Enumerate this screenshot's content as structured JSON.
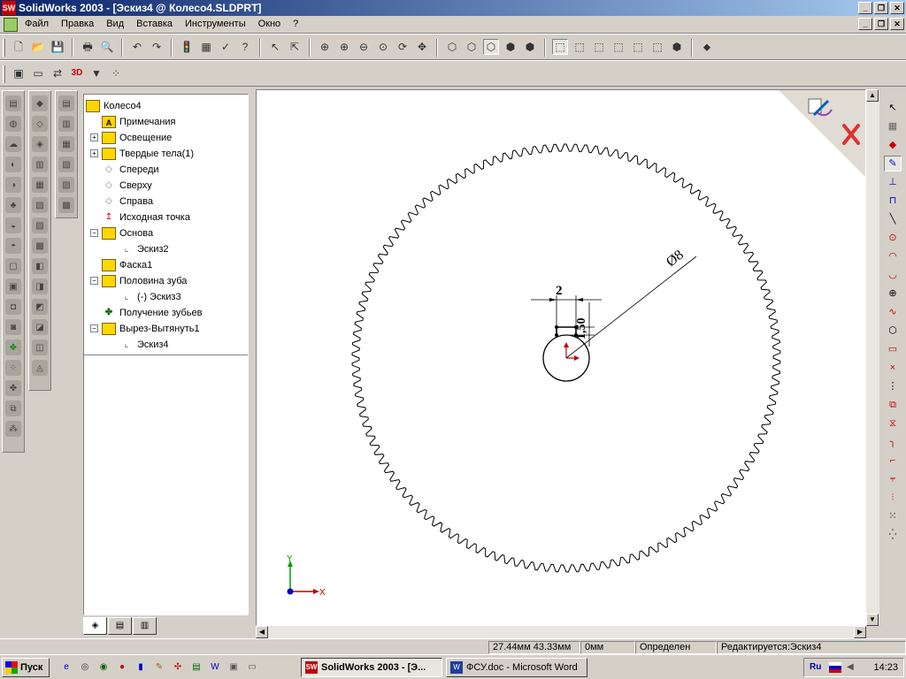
{
  "window": {
    "title": "SolidWorks 2003 - [Эскиз4 @ Колесо4.SLDPRT]",
    "app_icon_text": "SW"
  },
  "menu": {
    "items": [
      "Файл",
      "Правка",
      "Вид",
      "Вставка",
      "Инструменты",
      "Окно",
      "?"
    ]
  },
  "feature_tree": {
    "items": [
      {
        "label": "Колесо4",
        "icon": "part-icon"
      },
      {
        "label": "Примечания",
        "icon": "annotations-icon"
      },
      {
        "label": "Освещение",
        "icon": "lighting-icon",
        "expander": "+"
      },
      {
        "label": "Твердые тела(1)",
        "icon": "solid-bodies-icon",
        "expander": "+"
      },
      {
        "label": "Спереди",
        "icon": "plane-icon"
      },
      {
        "label": "Сверху",
        "icon": "plane-icon"
      },
      {
        "label": "Справа",
        "icon": "plane-icon"
      },
      {
        "label": "Исходная точка",
        "icon": "origin-icon"
      },
      {
        "label": "Основа",
        "icon": "extrude-icon",
        "expander": "−"
      },
      {
        "label": "Эскиз2",
        "icon": "sketch-icon"
      },
      {
        "label": "Фаска1",
        "icon": "chamfer-icon"
      },
      {
        "label": "Половина зуба",
        "icon": "extrude-icon",
        "expander": "−"
      },
      {
        "label": "(-) Эскиз3",
        "icon": "sketch-icon"
      },
      {
        "label": "Получение зубьев",
        "icon": "pattern-icon"
      },
      {
        "label": "Вырез-Вытянуть1",
        "icon": "cut-extrude-icon",
        "expander": "−"
      },
      {
        "label": "Эскиз4",
        "icon": "sketch-icon"
      }
    ]
  },
  "drawing": {
    "dim_width": "2",
    "dim_height": "1,50",
    "dim_diameter": "Ø8",
    "gear_teeth": 130,
    "axis_x": "X",
    "axis_y": "Y"
  },
  "status": {
    "coords": "27.44мм 43.33мм",
    "z": "0мм",
    "state": "Определен",
    "editing": "Редактируется:Эскиз4"
  },
  "taskbar": {
    "start": "Пуск",
    "tasks": [
      {
        "label": "SolidWorks 2003 - [Э...",
        "icon_color": "#c00000"
      },
      {
        "label": "ФСУ.doc - Microsoft Word",
        "icon_color": "#1f3f9f"
      }
    ],
    "lang": "Ru",
    "clock": "14:23"
  },
  "colors": {
    "title_start": "#0a246a",
    "title_end": "#a6caf0",
    "sketch_blue": "#0000c0",
    "origin_red": "#c00000",
    "confirm_red": "#e03030"
  }
}
